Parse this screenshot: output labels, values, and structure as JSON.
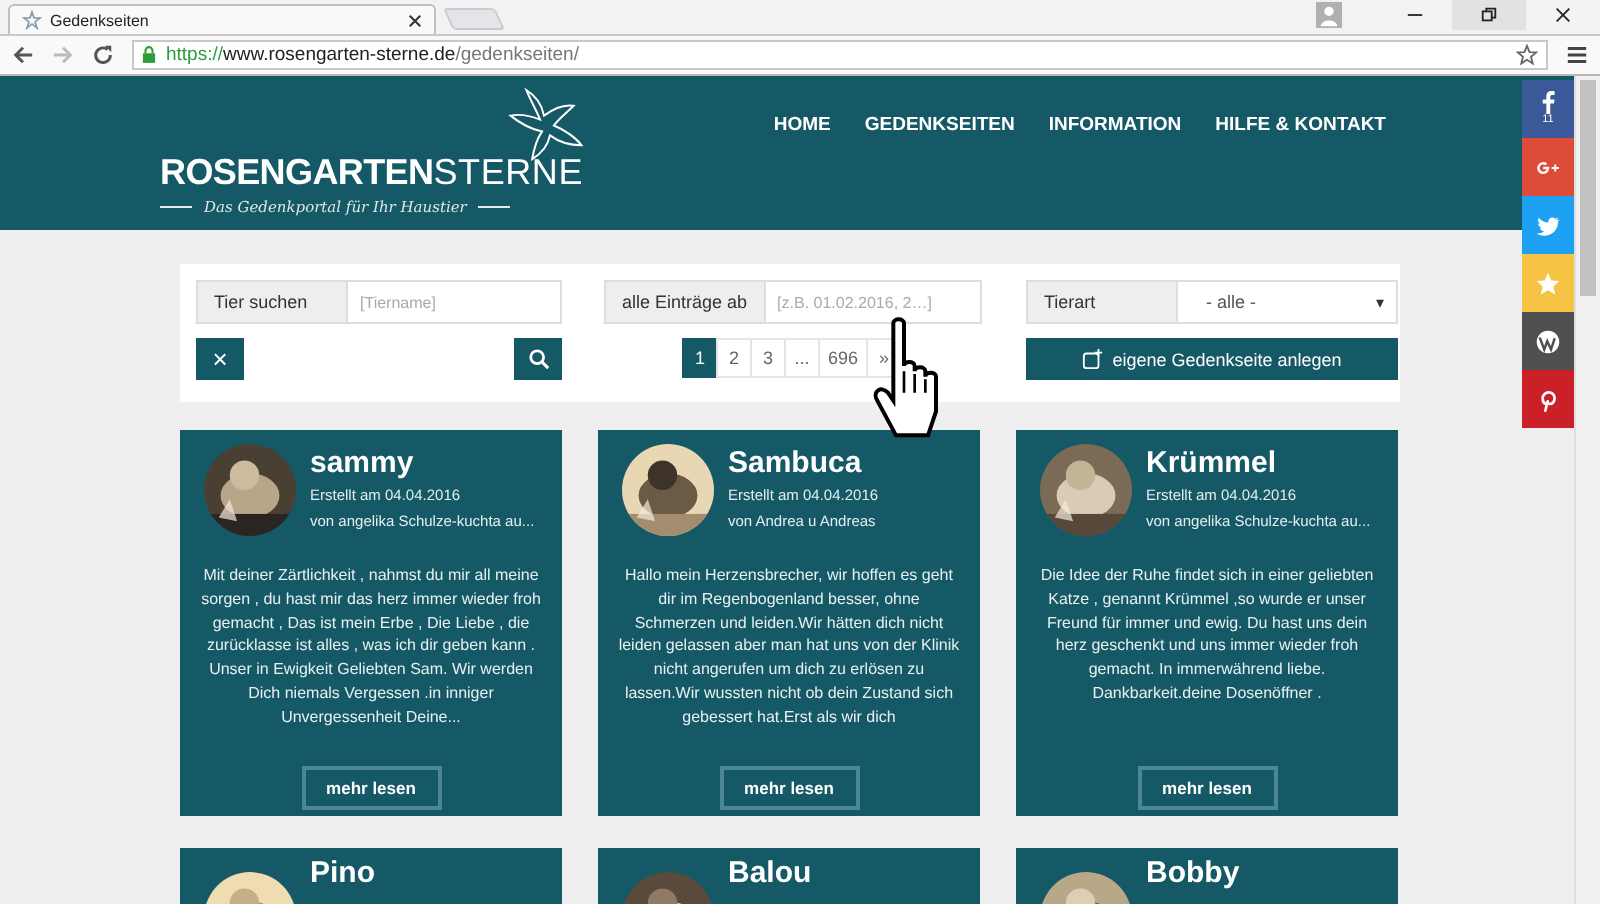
{
  "browser": {
    "tab_title": "Gedenkseiten",
    "url": {
      "scheme": "https://",
      "host": "www.rosengarten-sterne.de",
      "path": "/gedenkseiten/"
    }
  },
  "header": {
    "logo": {
      "bold": "ROSENGARTEN",
      "light": "STERNE",
      "tagline": "Das Gedenkportal für Ihr Haustier"
    },
    "nav": [
      "HOME",
      "GEDENKSEITEN",
      "INFORMATION",
      "HILFE & KONTAKT"
    ]
  },
  "filters": {
    "search": {
      "label": "Tier suchen",
      "placeholder": "[Tiername]"
    },
    "date": {
      "label": "alle Einträge ab",
      "placeholder": "[z.B. 01.02.2016, 2…]"
    },
    "type": {
      "label": "Tierart",
      "value": "- alle -",
      "caret": "▾"
    },
    "clear_button": "×",
    "create_button": "eigene Gedenkseite anlegen"
  },
  "pagination": [
    {
      "label": "1",
      "selected": true
    },
    {
      "label": "2",
      "selected": false
    },
    {
      "label": "3",
      "selected": false
    },
    {
      "label": "...",
      "selected": false
    },
    {
      "label": "696",
      "selected": false
    },
    {
      "label": "»",
      "selected": false
    }
  ],
  "cards": [
    {
      "name": "sammy",
      "created": "Erstellt am 04.04.2016",
      "author": "von angelika Schulze-kuchta au...",
      "text": "Mit deiner Zärtlichkeit , nahmst du mir all meine sorgen , du hast mir das herz immer wieder froh gemacht , Das ist mein Erbe , Die Liebe , die zurücklasse ist alles , was ich dir geben kann . Unser in Ewigkeit Geliebten Sam. Wir werden Dich niemals Vergessen .in inniger Unvergessenheit Deine...",
      "button": "mehr lesen"
    },
    {
      "name": "Sambuca",
      "created": "Erstellt am 04.04.2016",
      "author": "von Andrea u Andreas",
      "text": "Hallo mein Herzensbrecher, wir hoffen es geht dir im Regenbogenland besser, ohne Schmerzen und leiden.Wir hätten dich nicht leiden gelassen aber man hat uns von der Klinik nicht angerufen um dich zu erlösen zu lassen.Wir wussten nicht ob dein Zustand sich gebessert hat.Erst als wir dich",
      "button": "mehr lesen"
    },
    {
      "name": "Krümmel",
      "created": "Erstellt am 04.04.2016",
      "author": "von angelika Schulze-kuchta au...",
      "text": "Die Idee der Ruhe findet sich in einer geliebten Katze , genannt Krümmel ,so wurde er unser Freund für immer und ewig. Du hast uns dein herz geschenkt und uns immer wieder froh gemacht. In immerwährend liebe. Dankbarkeit.deine Dosenöffner .",
      "button": "mehr lesen"
    },
    {
      "name": "Pino"
    },
    {
      "name": "Balou"
    },
    {
      "name": "Bobby"
    }
  ],
  "share": [
    {
      "kind": "facebook",
      "count": "11",
      "color": "#3b5998"
    },
    {
      "kind": "googleplus",
      "color": "#dd4b39"
    },
    {
      "kind": "twitter",
      "color": "#1da1f2"
    },
    {
      "kind": "favorite",
      "color": "#f5c445"
    },
    {
      "kind": "wordpress",
      "color": "#505050"
    },
    {
      "kind": "pinterest",
      "color": "#cb2027"
    }
  ]
}
